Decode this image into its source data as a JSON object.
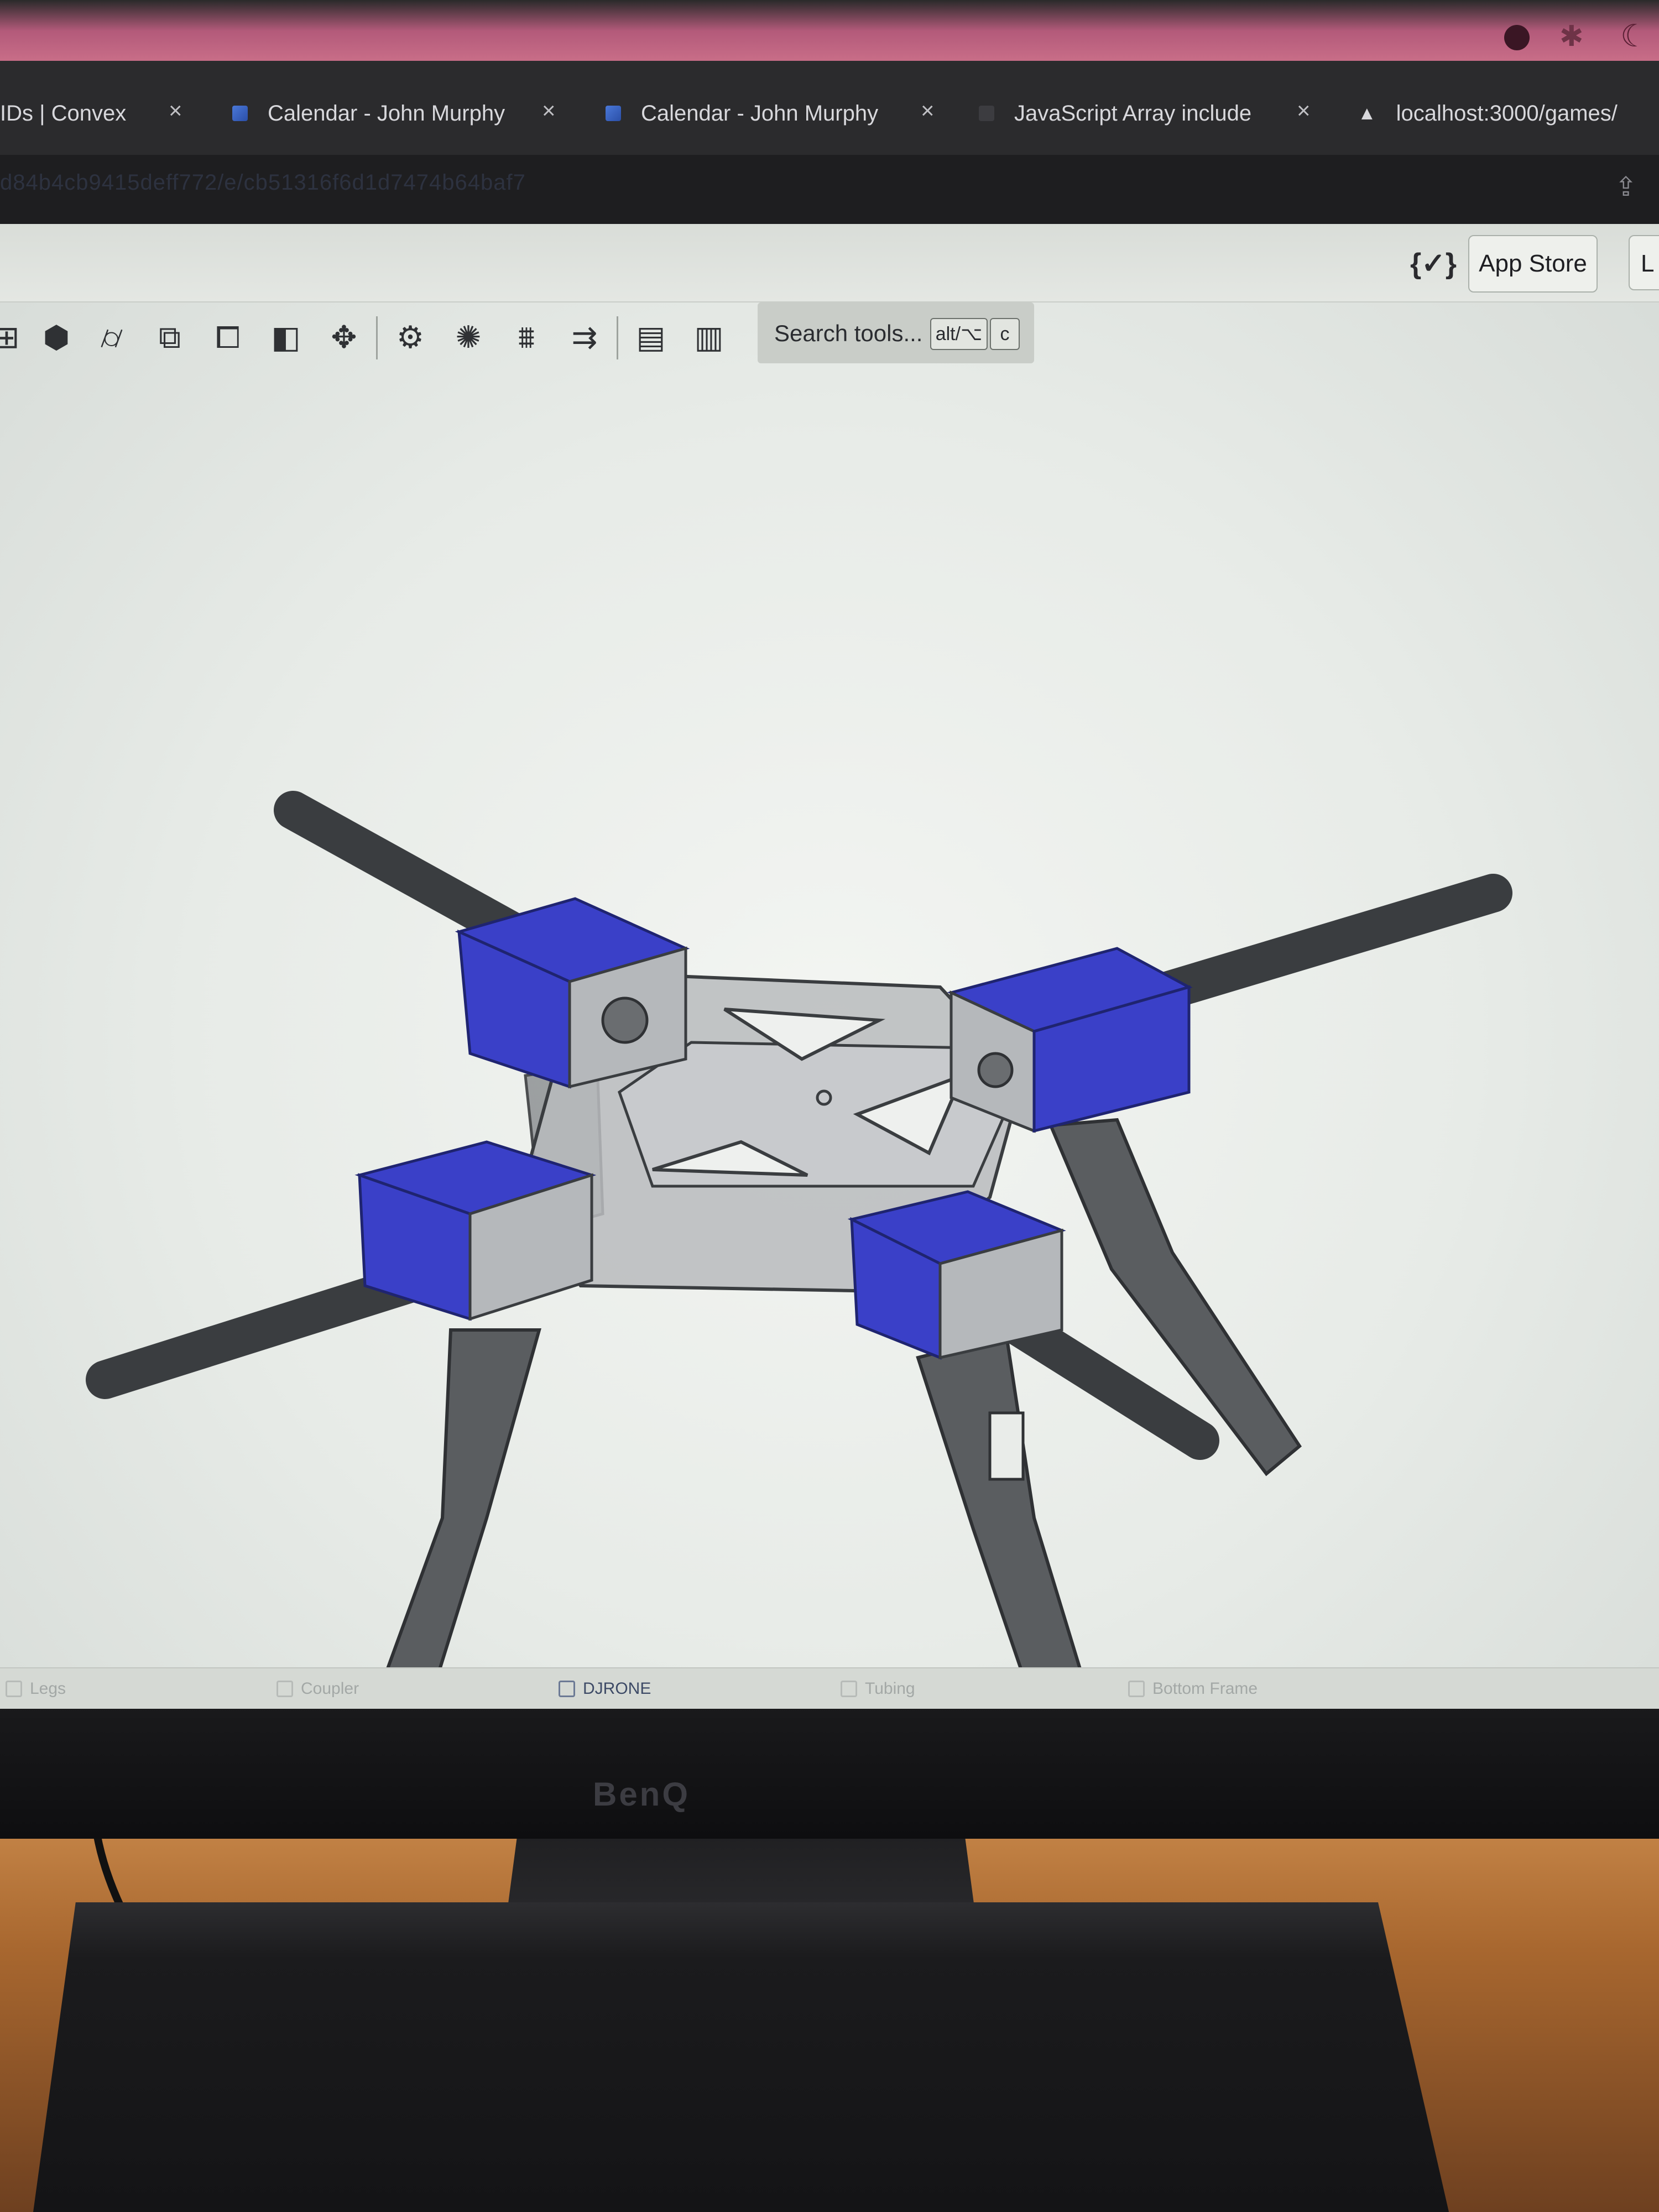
{
  "browser": {
    "tabs": [
      {
        "label": "IDs | Convex",
        "favicon": "convex-icon"
      },
      {
        "label": "Calendar - John Murphy",
        "favicon": "calendar-icon"
      },
      {
        "label": "Calendar - John Murphy",
        "favicon": "calendar-icon"
      },
      {
        "label": "JavaScript Array include",
        "favicon": "docs-icon"
      },
      {
        "label": "localhost:3000/games/",
        "favicon": "warning-icon"
      }
    ],
    "close_glyph": "×",
    "url": "d84b4cb9415deff772/e/cb51316f6d1d7474b64baf7"
  },
  "app": {
    "header": {
      "app_store_label": "App Store",
      "next_button_label": "L"
    },
    "toolbar": {
      "icons": [
        "import-icon",
        "part-studio-icon",
        "cylinder-icon",
        "mate-icon",
        "derived-icon",
        "section-icon",
        "explode-icon",
        "gear-icon",
        "gear-alt-icon",
        "mate-connector-icon",
        "replicate-icon",
        "drawing-icon",
        "bom-icon"
      ],
      "search_label": "Search tools...",
      "shortcut_keys": [
        "alt/⌥",
        "c"
      ]
    },
    "document_tabs": [
      {
        "label": "Legs",
        "active": false
      },
      {
        "label": "Coupler",
        "active": false
      },
      {
        "label": "DJRONE",
        "active": true
      },
      {
        "label": "Tubing",
        "active": false
      },
      {
        "label": "Bottom Frame",
        "active": false
      }
    ]
  },
  "monitor": {
    "brand": "BenQ"
  },
  "colors": {
    "accent_part": "#3a40c8",
    "frame_gray": "#b9bbbd",
    "tube_dark": "#3a3d40",
    "legs": "#5a5d60"
  }
}
